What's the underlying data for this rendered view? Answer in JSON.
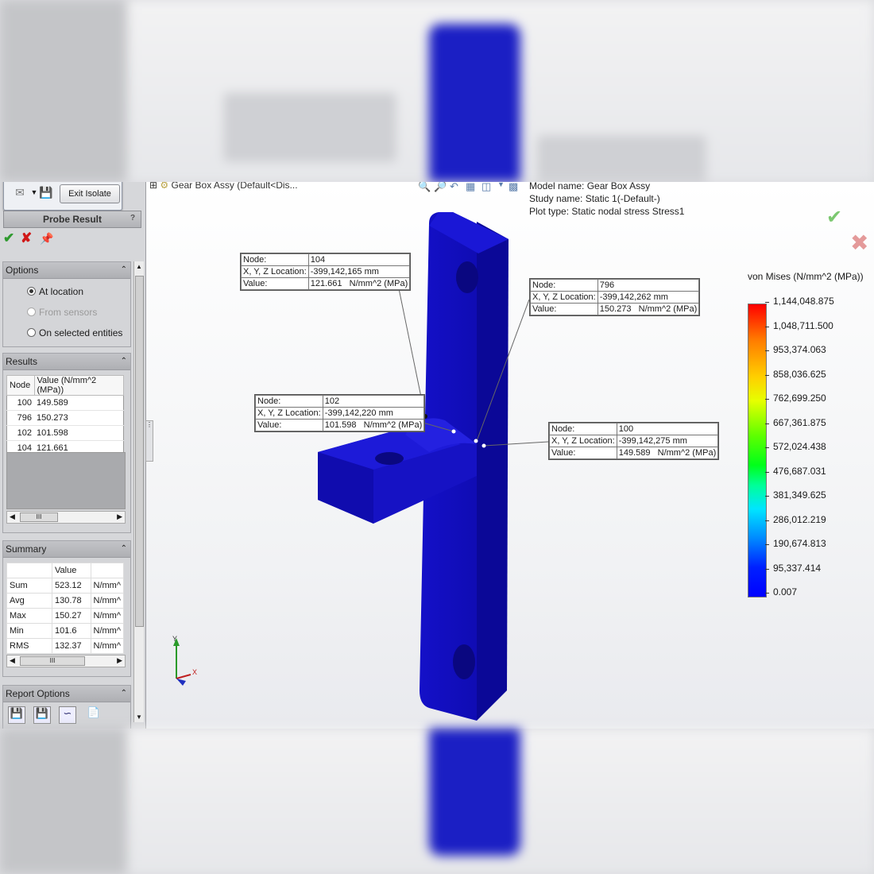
{
  "toolbar": {
    "exit_isolate_label": "Exit Isolate"
  },
  "panel": {
    "title": "Probe Result",
    "help": "?",
    "options": {
      "header": "Options",
      "at_location": "At location",
      "from_sensors": "From sensors",
      "on_selected_entities": "On selected entities"
    },
    "results": {
      "header": "Results",
      "col_node": "Node",
      "col_value": "Value (N/mm^2 (MPa))",
      "rows": [
        {
          "node": "100",
          "value": "149.589"
        },
        {
          "node": "796",
          "value": "150.273"
        },
        {
          "node": "102",
          "value": "101.598"
        },
        {
          "node": "104",
          "value": "121.661"
        }
      ]
    },
    "summary": {
      "header": "Summary",
      "col_value": "Value",
      "rows": [
        {
          "label": "Sum",
          "value": "523.12",
          "unit": "N/mm^"
        },
        {
          "label": "Avg",
          "value": "130.78",
          "unit": "N/mm^"
        },
        {
          "label": "Max",
          "value": "150.27",
          "unit": "N/mm^"
        },
        {
          "label": "Min",
          "value": "101.6",
          "unit": "N/mm^"
        },
        {
          "label": "RMS",
          "value": "132.37",
          "unit": "N/mm^"
        }
      ]
    },
    "report_options": {
      "header": "Report Options"
    }
  },
  "viewport": {
    "tree_label": "Gear Box Assy  (Default<Dis...",
    "model_name": "Model name: Gear Box Assy",
    "study_name": "Study name: Static 1(-Default-)",
    "plot_type": "Plot type: Static nodal stress Stress1"
  },
  "callouts": {
    "c104": {
      "node_label": "Node:",
      "node": "104",
      "loc_label": "X, Y, Z Location:",
      "loc": "-399,142,165 mm",
      "val_label": "Value:",
      "value": "121.661",
      "unit": "N/mm^2 (MPa)"
    },
    "c796": {
      "node_label": "Node:",
      "node": "796",
      "loc_label": "X, Y, Z Location:",
      "loc": "-399,142,262 mm",
      "val_label": "Value:",
      "value": "150.273",
      "unit": "N/mm^2 (MPa)"
    },
    "c102": {
      "node_label": "Node:",
      "node": "102",
      "loc_label": "X, Y, Z Location:",
      "loc": "-399,142,220 mm",
      "val_label": "Value:",
      "value": "101.598",
      "unit": "N/mm^2 (MPa)"
    },
    "c100": {
      "node_label": "Node:",
      "node": "100",
      "loc_label": "X, Y, Z Location:",
      "loc": "-399,142,275 mm",
      "val_label": "Value:",
      "value": "149.589",
      "unit": "N/mm^2 (MPa)"
    }
  },
  "legend": {
    "title": "von Mises (N/mm^2 (MPa))",
    "labels": [
      "1,144,048.875",
      "1,048,711.500",
      "953,374.063",
      "858,036.625",
      "762,699.250",
      "667,361.875",
      "572,024.438",
      "476,687.031",
      "381,349.625",
      "286,012.219",
      "190,674.813",
      "95,337.414",
      "0.007"
    ]
  },
  "axes": {
    "y": "Y",
    "x": "X"
  },
  "colors": {
    "part_blue": "#1410c8",
    "accept": "#3aa63a",
    "cancel": "#d62020"
  }
}
